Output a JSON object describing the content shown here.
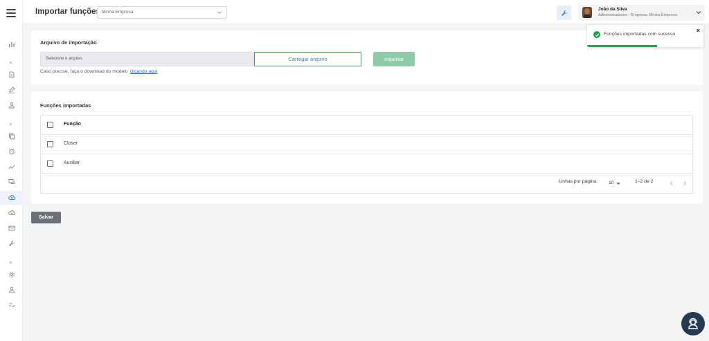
{
  "header": {
    "title": "Importar funções",
    "company_select": {
      "value": "Minha Empresa"
    },
    "user": {
      "name": "João da Silva",
      "role": "Administradores - Empresa: Minha Empresa"
    }
  },
  "sidebar": {
    "items": [
      {
        "icon": "chart-icon"
      },
      {
        "icon": "document-icon"
      },
      {
        "icon": "pencil-icon"
      },
      {
        "icon": "user-icon"
      },
      {
        "icon": "copy-icon"
      },
      {
        "icon": "alarm-icon"
      },
      {
        "icon": "trend-icon"
      },
      {
        "icon": "chat-icon"
      },
      {
        "icon": "cloud-upload-icon",
        "active": true
      },
      {
        "icon": "cloud-download-icon"
      },
      {
        "icon": "mail-icon"
      },
      {
        "icon": "wrench-icon"
      },
      {
        "icon": "gear-icon"
      },
      {
        "icon": "user-alt-icon"
      },
      {
        "icon": "list-check-icon"
      }
    ]
  },
  "import_card": {
    "title": "Arquivo de importação",
    "file_placeholder": "Selecione o arquivo",
    "upload_label": "Carregar arquivo",
    "import_label": "Importar",
    "hint_text": "Caso precise, faça o download do modelo",
    "hint_link": "clicando aqui"
  },
  "table_card": {
    "title": "Funções importadas",
    "column_header": "Função",
    "rows": [
      {
        "funcao": "Closer"
      },
      {
        "funcao": "Auxiliar"
      }
    ],
    "rows_per_page_label": "Linhas por página:",
    "rows_per_page": "10",
    "range": "1–2 de 2"
  },
  "save_label": "Salvar",
  "toast": {
    "message": "Funções importadas com sucesso",
    "status": "success",
    "progress": 0.6
  },
  "colors": {
    "accent": "#3f7ec9",
    "success": "#1fa34a",
    "import_button": "#8fcba8",
    "save_button": "#6c7178",
    "fab": "#263a52"
  }
}
